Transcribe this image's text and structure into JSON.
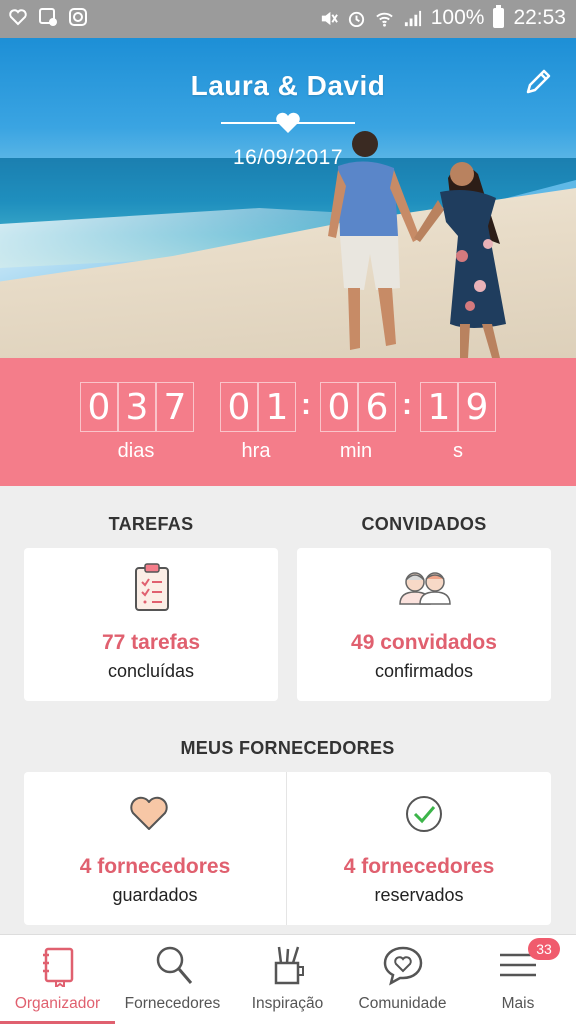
{
  "status_bar": {
    "battery_text": "100%",
    "time": "22:53"
  },
  "hero": {
    "couple_names": "Laura & David",
    "wedding_date": "16/09/2017"
  },
  "countdown": {
    "days": [
      "0",
      "3",
      "7"
    ],
    "hours": [
      "0",
      "1"
    ],
    "minutes": [
      "0",
      "6"
    ],
    "seconds": [
      "1",
      "9"
    ],
    "labels": {
      "days": "dias",
      "hours": "hra",
      "minutes": "min",
      "seconds": "s"
    }
  },
  "tasks": {
    "heading": "TAREFAS",
    "count_text": "77 tarefas",
    "status_text": "concluídas"
  },
  "guests": {
    "heading": "CONVIDADOS",
    "count_text": "49 convidados",
    "status_text": "confirmados"
  },
  "vendors": {
    "heading": "MEUS FORNECEDORES",
    "saved_count": "4 fornecedores",
    "saved_label": "guardados",
    "booked_count": "4 fornecedores",
    "booked_label": "reservados"
  },
  "bottom_nav": {
    "items": [
      {
        "label": "Organizador",
        "icon": "notebook-icon",
        "active": true
      },
      {
        "label": "Fornecedores",
        "icon": "search-icon",
        "active": false
      },
      {
        "label": "Inspiração",
        "icon": "pencil-cup-icon",
        "active": false
      },
      {
        "label": "Comunidade",
        "icon": "chat-heart-icon",
        "active": false
      },
      {
        "label": "Mais",
        "icon": "menu-icon",
        "active": false
      }
    ],
    "badge_count": "33"
  },
  "colors": {
    "accent": "#e0606f",
    "countdown_bg": "#f47d8a",
    "statusbar_bg": "#9b9b9b"
  }
}
